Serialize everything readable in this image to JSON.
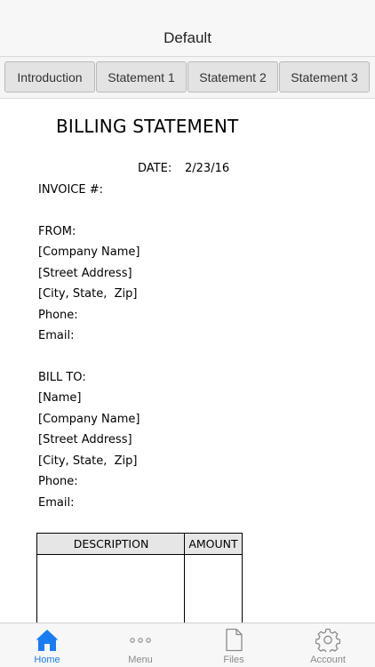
{
  "navbar": {
    "title": "Default"
  },
  "tabs": [
    {
      "label": "Introduction"
    },
    {
      "label": "Statement 1"
    },
    {
      "label": "Statement 2"
    },
    {
      "label": "Statement 3"
    }
  ],
  "document": {
    "title": "BILLING STATEMENT",
    "date_label": "DATE:",
    "date_value": "2/23/16",
    "invoice_label": "INVOICE #:",
    "from_label": "FROM:",
    "from_lines": [
      "[Company Name]",
      "[Street Address]",
      "[City, State,  Zip]",
      "Phone:",
      "Email:"
    ],
    "bill_to_label": "BILL TO:",
    "bill_to_lines": [
      "[Name]",
      "[Company Name]",
      "[Street Address]",
      "[City, State,  Zip]",
      "Phone:",
      "Email:"
    ],
    "table": {
      "headers": [
        "DESCRIPTION",
        "AMOUNT"
      ]
    }
  },
  "bottom_tabs": [
    {
      "label": "Home",
      "icon": "home-icon",
      "active": true
    },
    {
      "label": "Menu",
      "icon": "more-dots-icon"
    },
    {
      "label": "Files",
      "icon": "file-icon"
    },
    {
      "label": "Account",
      "icon": "gear-icon"
    }
  ],
  "colors": {
    "accent": "#1a7cf4",
    "inactive": "#8a8a8a"
  }
}
